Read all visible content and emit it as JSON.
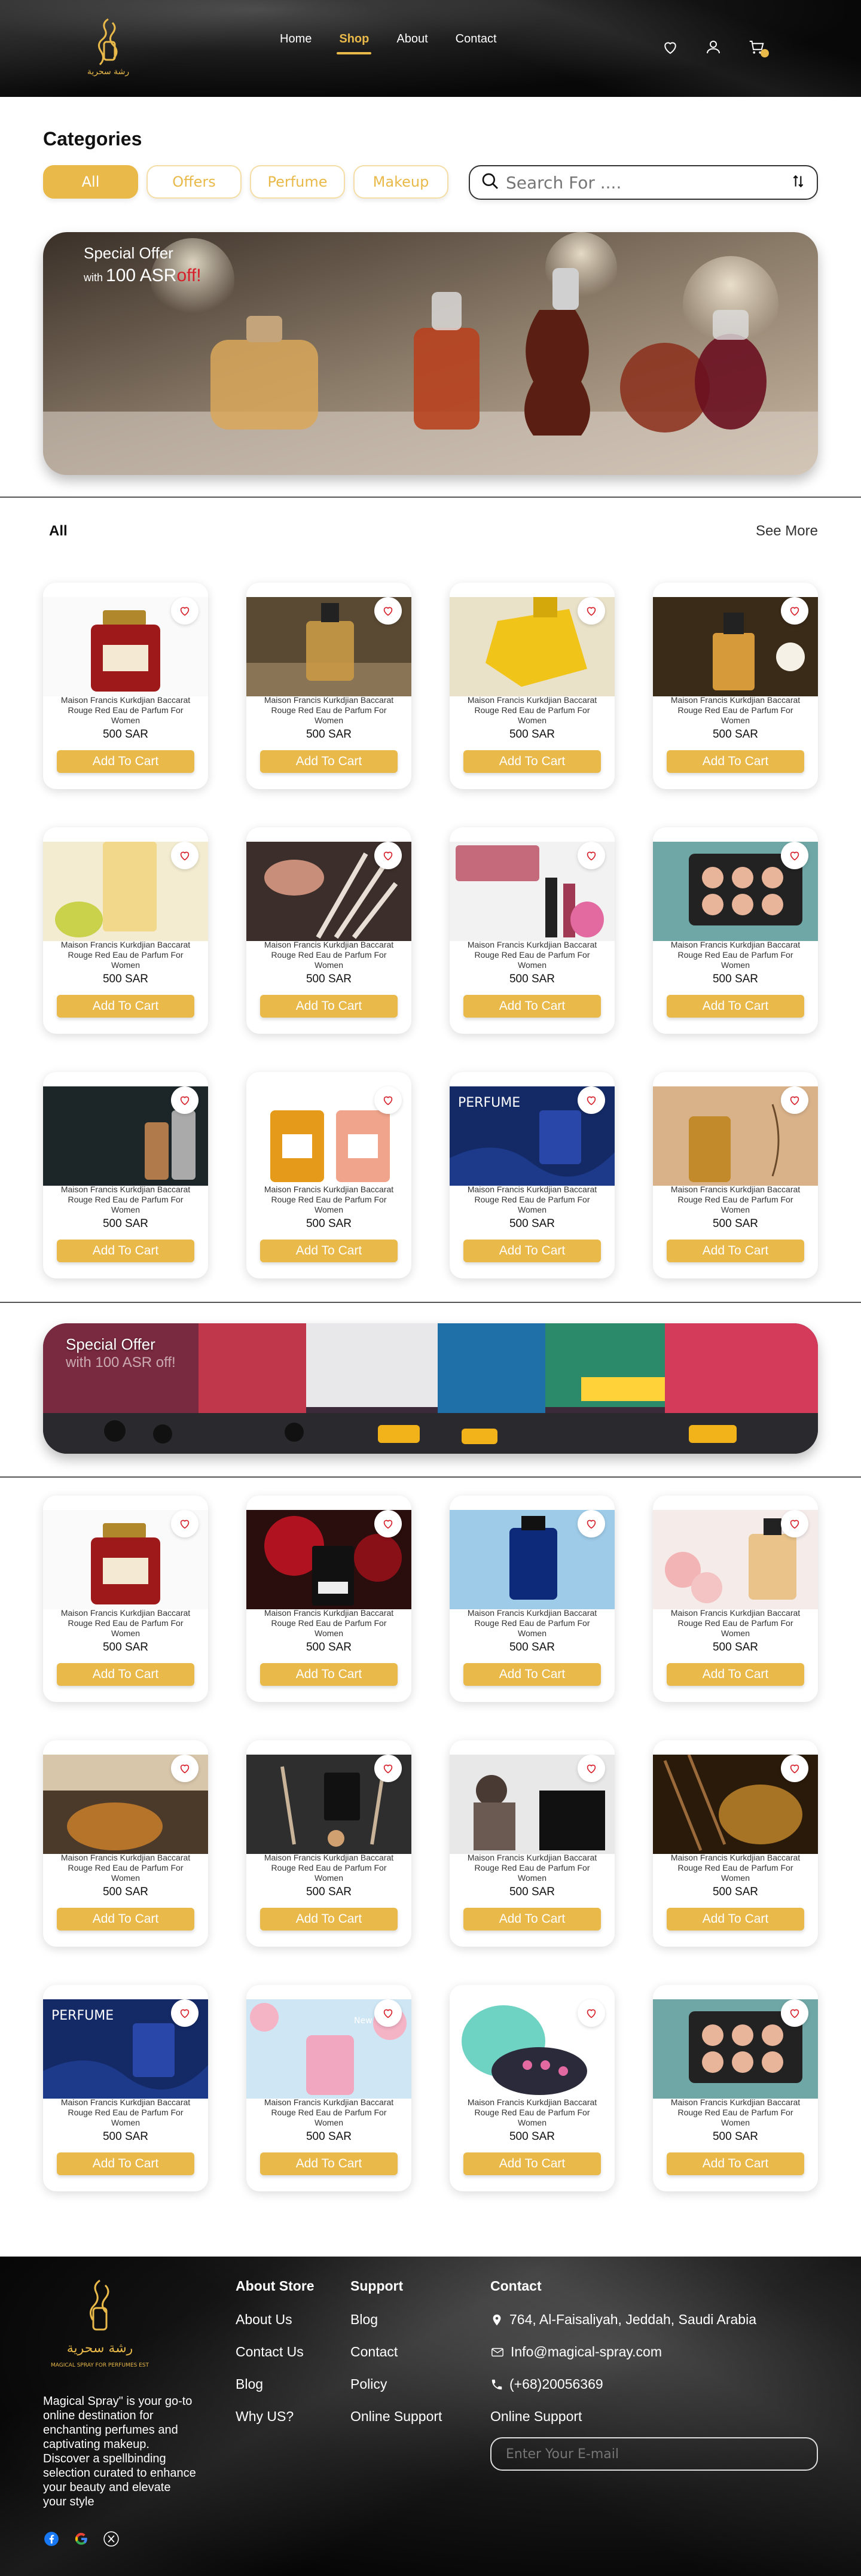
{
  "nav": {
    "home": "Home",
    "shop": "Shop",
    "about": "About",
    "contact": "Contact"
  },
  "logo": {
    "arabic": "رشة سحرية",
    "english": "MAGICAL SPRAY FOR PERFUMES EST"
  },
  "categories": {
    "title": "Categories",
    "items": [
      "All",
      "Offers",
      "Perfume",
      "Makeup"
    ]
  },
  "search": {
    "placeholder": "Search For ...."
  },
  "banner": {
    "line1": "Special Offer",
    "with": "with ",
    "amount": "100 ASR",
    "off": "off!"
  },
  "section": {
    "title": "All",
    "see_more": "See More"
  },
  "product": {
    "name": "Maison Francis Kurkdjian Baccarat Rouge Red Eau de Parfum For Women",
    "price": "500 SAR",
    "cta": "Add To Cart"
  },
  "banner2": {
    "line1": "Special Offer",
    "line2": "with 100 ASR off!"
  },
  "footer": {
    "description": "Magical Spray\" is your go-to online destination for enchanting perfumes and captivating makeup. Discover a spellbinding selection curated to enhance your beauty and elevate your style",
    "about_title": "About Store",
    "about_links": [
      "About Us",
      "Contact Us",
      "Blog",
      "Why US?"
    ],
    "support_title": "Support",
    "support_links": [
      "Blog",
      "Contact",
      "Policy",
      "Online Support"
    ],
    "contact_title": "Contact",
    "address": "764, Al-Faisaliyah, Jeddah, Saudi Arabia",
    "email": "Info@magical-spray.com",
    "phone": "(+68)20056369",
    "online_support": "Online Support",
    "newsletter_placeholder": "Enter Your E-mail"
  },
  "colors": {
    "accent": "#e9b949",
    "dark": "#111111",
    "offer_red": "#d61f2a"
  }
}
